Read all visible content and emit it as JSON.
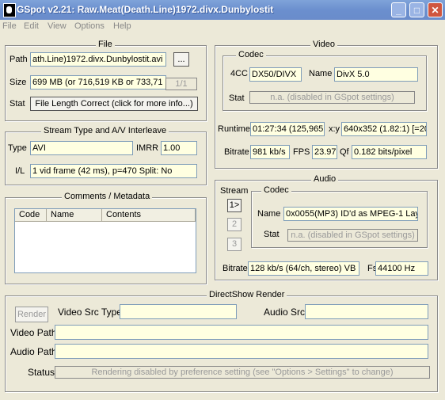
{
  "window": {
    "title": "GSpot v2.21: Raw.Meat(Death.Line)1972.divx.Dunbylostit",
    "buttons": {
      "minimize": "_",
      "maximize": "□",
      "close": "✕"
    }
  },
  "menu": [
    "File",
    "Edit",
    "View",
    "Options",
    "Help"
  ],
  "file": {
    "title": "File",
    "path_label": "Path",
    "path_value": "ath.Line)1972.divx.Dunbylostit.avi",
    "browse_label": "...",
    "size_label": "Size",
    "size_value": "699 MB (or 716,519 KB or 733,71",
    "part_label": "1/1",
    "stat_label": "Stat",
    "stat_button": "File Length Correct (click for more info...)"
  },
  "stream": {
    "title": "Stream Type and A/V Interleave",
    "type_label": "Type",
    "type_value": "AVI",
    "imrr_label": "IMRR",
    "imrr_value": "1.00",
    "il_label": "I/L",
    "il_value": "1 vid frame (42 ms), p=470  Split: No"
  },
  "comments": {
    "title": "Comments / Metadata",
    "columns": [
      "Code",
      "Name",
      "Contents"
    ]
  },
  "video": {
    "title": "Video",
    "codec_title": "Codec",
    "fourcc_label": "4CC",
    "fourcc_value": "DX50/DIVX",
    "name_label": "Name",
    "name_value": "DivX 5.0",
    "stat_label": "Stat",
    "stat_value": "n.a. (disabled in GSpot settings)",
    "runtime_label": "Runtime",
    "runtime_value": "01:27:34 (125,965",
    "xy_label": "x:y",
    "xy_value": "640x352 (1.82:1) [=20",
    "bitrate_label": "Bitrate",
    "bitrate_value": "981 kb/s",
    "fps_label": "FPS",
    "fps_value": "23.97",
    "qf_label": "Qf",
    "qf_value": "0.182 bits/pixel"
  },
  "audio": {
    "title": "Audio",
    "stream_label": "Stream",
    "streams": [
      "1>",
      "2",
      "3"
    ],
    "codec_title": "Codec",
    "name_label": "Name",
    "name_value": "0x0055(MP3) ID'd as MPEG-1 Lay",
    "stat_label": "Stat",
    "stat_value": "n.a. (disabled in GSpot settings)",
    "bitrate_label": "Bitrate",
    "bitrate_value": "128 kb/s (64/ch, stereo) VB",
    "fs_label": "Fs",
    "fs_value": "44100 Hz"
  },
  "render": {
    "title": "DirectShow Render",
    "render_button": "Render",
    "video_src_label": "Video Src Type",
    "video_src_value": "",
    "audio_src_label": "Audio Src",
    "audio_src_value": "",
    "video_path_label": "Video Path",
    "video_path_value": "",
    "audio_path_label": "Audio Path",
    "audio_path_value": "",
    "status_label": "Status",
    "status_value": "Rendering disabled by preference setting (see \"Options > Settings\" to change)"
  }
}
